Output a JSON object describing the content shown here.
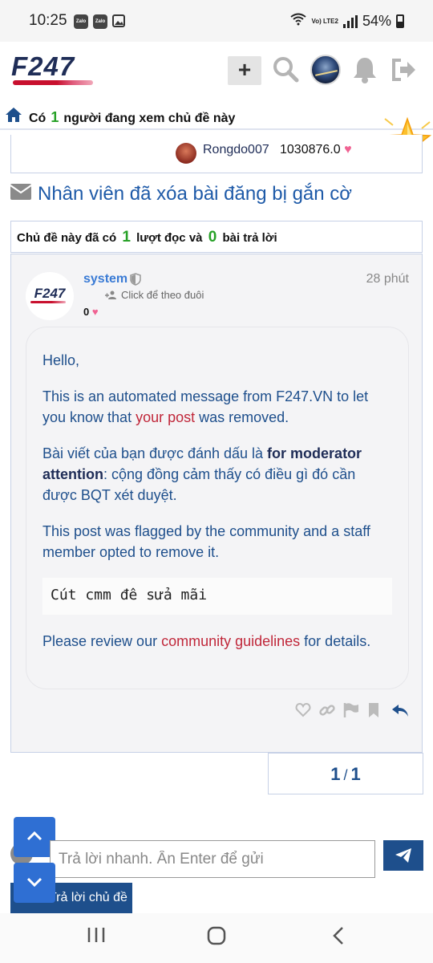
{
  "status_bar": {
    "time": "10:25",
    "apps": [
      "Zalo",
      "Zalo"
    ],
    "network": "Vo) LTE2",
    "battery": "54%"
  },
  "header": {
    "logo": "F247",
    "new_button": "+"
  },
  "viewing": {
    "prefix": "Có",
    "count": "1",
    "suffix": "người đang xem chủ đề này"
  },
  "author": {
    "name": "Rongdo007",
    "score": "1030876.0"
  },
  "topic": {
    "title": "Nhân viên đã xóa bài đăng bị gắn cờ"
  },
  "stats": {
    "prefix": "Chủ đề này đã có",
    "views": "1",
    "views_label": "lượt đọc và",
    "replies": "0",
    "replies_label": "bài trả lời"
  },
  "post": {
    "avatar_text": "F247",
    "username": "system",
    "follow": "Click để theo đuôi",
    "score": "0",
    "time": "28 phút",
    "greeting": "Hello,",
    "line1_a": "This is an automated message from F247.VN to let you know that ",
    "line1_link": "your post",
    "line1_b": " was removed.",
    "line2_a": "Bài viết của bạn được đánh dấu là ",
    "line2_bold": "for moderator attention",
    "line2_b": ": cộng đồng cảm thấy có điều gì đó cần được BQT xét duyệt.",
    "line3": "This post was flagged by the community and a staff member opted to remove it.",
    "code": "Cút cmm đê sửa mãi",
    "line4_a": "Please review our ",
    "line4_link": "community guidelines",
    "line4_b": " for details."
  },
  "pagination": {
    "current": "1",
    "separator": "/",
    "total": "1"
  },
  "quick_reply": {
    "placeholder": "Trả lời nhanh. Ấn Enter để gửi",
    "reply_topic": "Trả lời chủ đề"
  },
  "colors": {
    "brand_navy": "#1f2d57",
    "link_blue": "#1e5aa8",
    "accent_red": "#c0273a",
    "count_green": "#27a127",
    "heart_pink": "#f06292"
  }
}
